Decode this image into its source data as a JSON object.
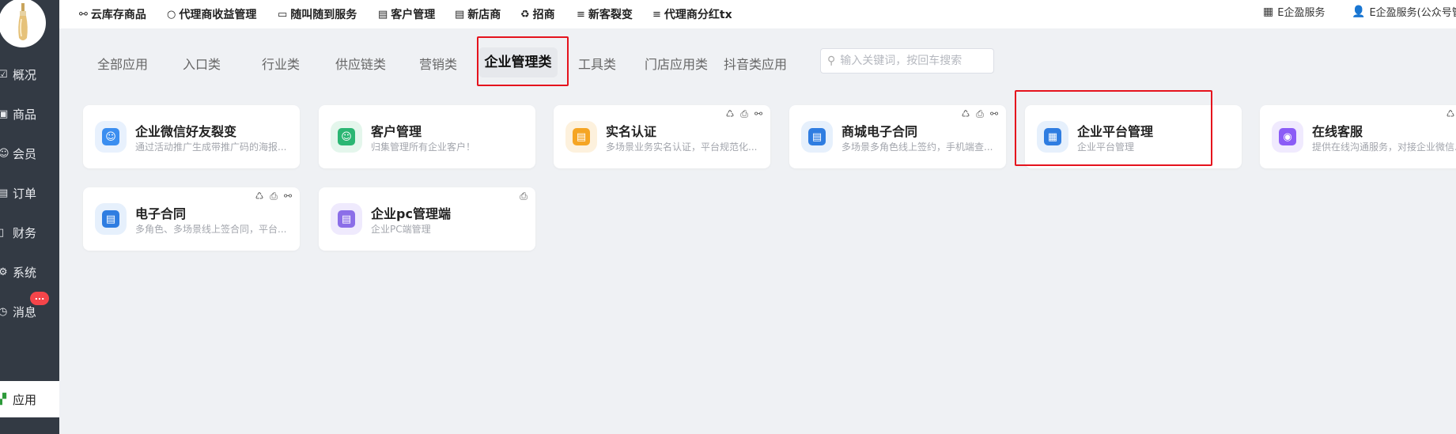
{
  "topbar": {
    "items": [
      {
        "icon": "link-icon",
        "glyph": "⚯",
        "label": "云库存商品"
      },
      {
        "icon": "circle-icon",
        "glyph": "○",
        "label": "代理商收益管理"
      },
      {
        "icon": "card-icon",
        "glyph": "▭",
        "label": "随叫随到服务"
      },
      {
        "icon": "doc-icon",
        "glyph": "▤",
        "label": "客户管理"
      },
      {
        "icon": "doc-icon",
        "glyph": "▤",
        "label": "新店商"
      },
      {
        "icon": "recycle-icon",
        "glyph": "♻",
        "label": "招商"
      },
      {
        "icon": "menu-icon",
        "glyph": "≡",
        "label": "新客裂变"
      },
      {
        "icon": "menu-icon",
        "glyph": "≡",
        "label": "代理商分红tx"
      }
    ],
    "right": [
      {
        "icon": "grid-icon",
        "glyph": "▦",
        "label": "E企盈服务"
      },
      {
        "icon": "user-icon",
        "glyph": "👤",
        "label": "E企盈服务(公众号管理"
      }
    ]
  },
  "sidebar": {
    "items": [
      {
        "label": "概况",
        "glyph": "☑"
      },
      {
        "label": "商品",
        "glyph": "▣"
      },
      {
        "label": "会员",
        "glyph": "☺"
      },
      {
        "label": "订单",
        "glyph": "▤"
      },
      {
        "label": "财务",
        "glyph": "▯"
      },
      {
        "label": "系统",
        "glyph": "⚙"
      },
      {
        "label": "消息",
        "glyph": "◷"
      }
    ],
    "message_badge": "...",
    "active": {
      "label": "应用",
      "glyph": "▞"
    }
  },
  "tabs": [
    "全部应用",
    "入口类",
    "行业类",
    "供应链类",
    "营销类",
    "企业管理类",
    "工具类",
    "门店应用类",
    "抖音类应用"
  ],
  "active_tab": "企业管理类",
  "search": {
    "placeholder": "输入关键词，按回车搜索",
    "value": ""
  },
  "cards": [
    {
      "title": "企业微信好友裂变",
      "desc": "通过活动推广生成带推广码的海报...",
      "color": "#3b8ef0",
      "bg": "#e8f1fd",
      "glyph": "☺",
      "actions": []
    },
    {
      "title": "客户管理",
      "desc": "归集管理所有企业客户！",
      "color": "#2bb673",
      "bg": "#e4f6ec",
      "glyph": "☺",
      "actions": []
    },
    {
      "title": "实名认证",
      "desc": "多场景业务实名认证，平台规范化...",
      "color": "#f5a524",
      "bg": "#fdf1dd",
      "glyph": "▤",
      "actions": [
        "♺",
        "⎙",
        "⚯"
      ]
    },
    {
      "title": "商城电子合同",
      "desc": "多场景多角色线上签约，手机端查...",
      "color": "#2f7de1",
      "bg": "#e6f0fc",
      "glyph": "▤",
      "actions": [
        "♺",
        "⎙",
        "⚯"
      ]
    },
    {
      "title": "企业平台管理",
      "desc": "企业平台管理",
      "color": "#2f7de1",
      "bg": "#e6f0fc",
      "glyph": "▦",
      "actions": []
    },
    {
      "title": "在线客服",
      "desc": "提供在线沟通服务，对接企业微信...",
      "color": "#8b5cf6",
      "bg": "#f0eafe",
      "glyph": "◉",
      "actions": [
        "♺",
        "⎙"
      ]
    },
    {
      "title": "电子合同",
      "desc": "多角色、多场景线上签合同，平台...",
      "color": "#2f7de1",
      "bg": "#e6f0fc",
      "glyph": "▤",
      "actions": [
        "♺",
        "⎙",
        "⚯"
      ]
    },
    {
      "title": "企业pc管理端",
      "desc": "企业PC端管理",
      "color": "#8b6ee8",
      "bg": "#efeafd",
      "glyph": "▤",
      "actions": [
        "⎙"
      ]
    }
  ]
}
